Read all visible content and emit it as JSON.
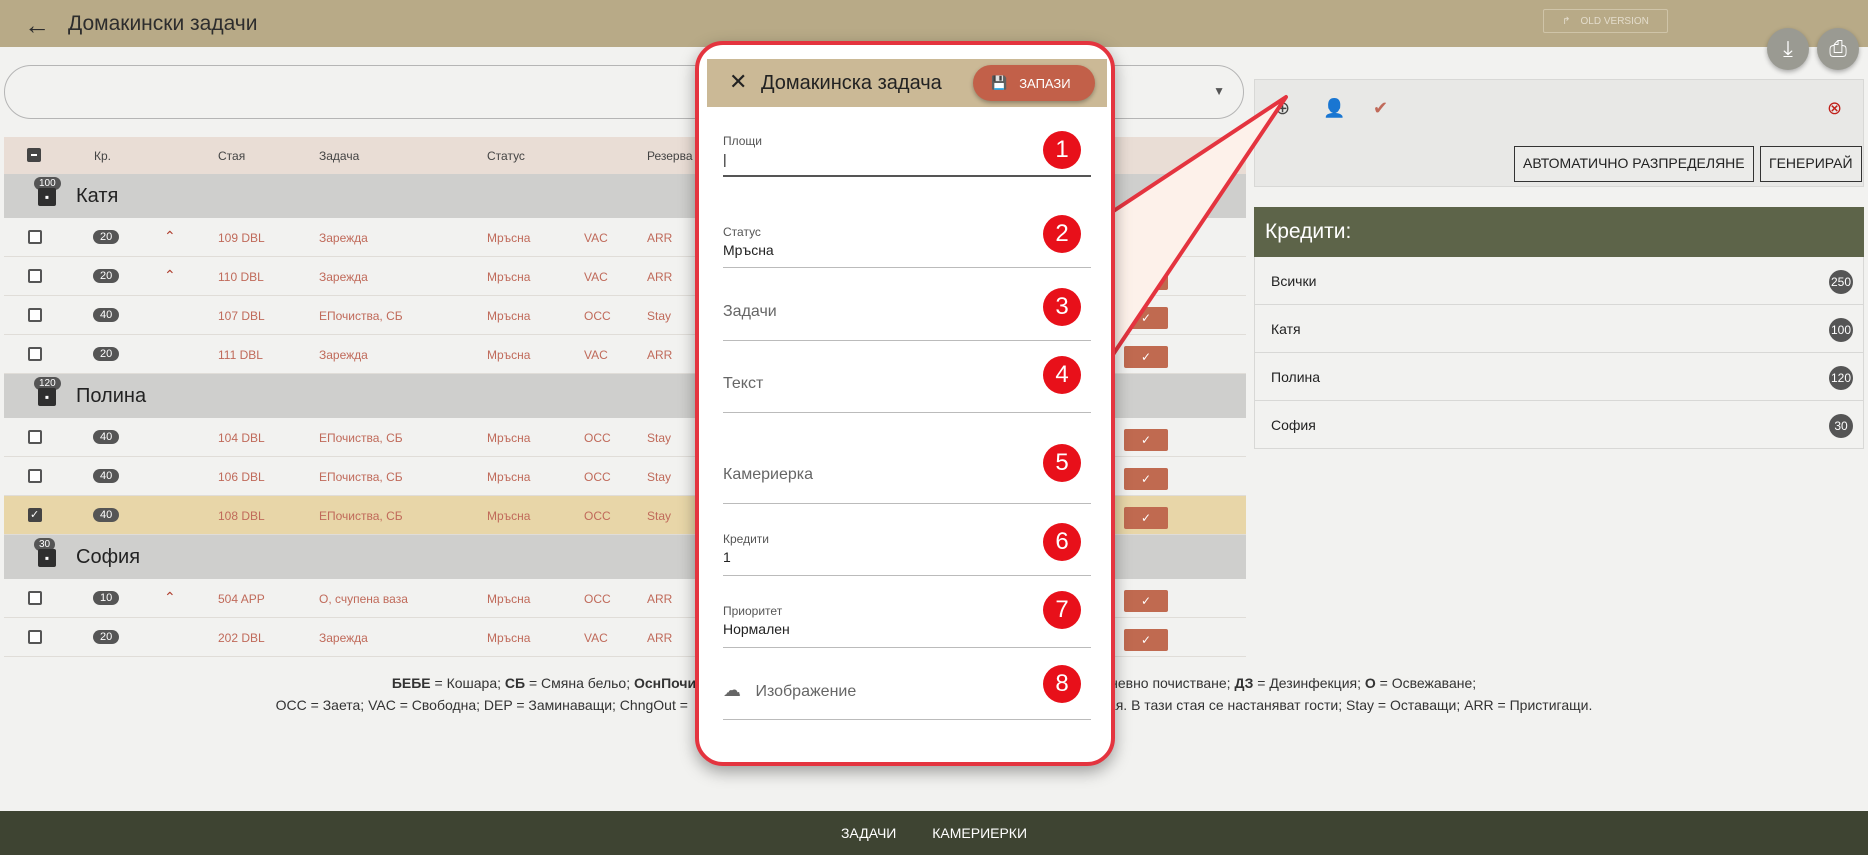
{
  "header": {
    "title": "Домакински задачи",
    "old_version": "OLD VERSION"
  },
  "table": {
    "columns": [
      "Кр.",
      "Стая",
      "Задача",
      "Статус",
      "Резерва"
    ],
    "groups": [
      {
        "name": "Катя",
        "credits": "100",
        "rows": [
          {
            "credits": "20",
            "up": true,
            "room": "109 DBL",
            "task": "Зарежда",
            "status": "Мръсна",
            "occ": "VAC",
            "res": "ARR",
            "checked": false
          },
          {
            "credits": "20",
            "up": true,
            "room": "110 DBL",
            "task": "Зарежда",
            "status": "Мръсна",
            "occ": "VAC",
            "res": "ARR",
            "checked": false
          },
          {
            "credits": "40",
            "up": false,
            "room": "107 DBL",
            "task": "ЕПочиства, СБ",
            "status": "Мръсна",
            "occ": "OCC",
            "res": "Stay",
            "checked": false
          },
          {
            "credits": "20",
            "up": false,
            "room": "111 DBL",
            "task": "Зарежда",
            "status": "Мръсна",
            "occ": "VAC",
            "res": "ARR",
            "checked": false
          }
        ]
      },
      {
        "name": "Полина",
        "credits": "120",
        "rows": [
          {
            "credits": "40",
            "up": false,
            "room": "104 DBL",
            "task": "ЕПочиства, СБ",
            "status": "Мръсна",
            "occ": "OCC",
            "res": "Stay",
            "checked": false
          },
          {
            "credits": "40",
            "up": false,
            "room": "106 DBL",
            "task": "ЕПочиства, СБ",
            "status": "Мръсна",
            "occ": "OCC",
            "res": "Stay",
            "checked": false
          },
          {
            "credits": "40",
            "up": false,
            "room": "108 DBL",
            "task": "ЕПочиства, СБ",
            "status": "Мръсна",
            "occ": "OCC",
            "res": "Stay",
            "checked": true
          }
        ]
      },
      {
        "name": "София",
        "credits": "30",
        "rows": [
          {
            "credits": "10",
            "up": true,
            "room": "504 APP",
            "task": "О, счупена ваза",
            "status": "Мръсна",
            "occ": "OCC",
            "res": "ARR",
            "checked": false
          },
          {
            "credits": "20",
            "up": false,
            "room": "202 DBL",
            "task": "Зарежда",
            "status": "Мръсна",
            "occ": "VAC",
            "res": "ARR",
            "checked": false
          }
        ]
      }
    ]
  },
  "legend": {
    "line1_a": "БЕБЕ",
    "line1_b": " = Кошара; ",
    "line1_c": "СБ",
    "line1_d": " = Смяна бельо; ",
    "line1_e": "ОснПочист",
    "line1_gap": "                                                                                ",
    "line1_f": "Ежедневно почистване; ",
    "line1_g": "ДЗ",
    "line1_h": " = Дезинфекция; ",
    "line1_i": "О",
    "line1_j": " = Освежаване;",
    "line2_left": "OCC = Заета; VAC = Свободна; DEP = Заминаващи; ChngOut =",
    "line2_right": "ая. В тази стая се настаняват гости; Stay = Оставащи; ARR = Пристигащи."
  },
  "right_panel": {
    "auto_button": "АВТОМАТИЧНО РАЗПРЕДЕЛЯНЕ",
    "generate_button": "ГЕНЕРИРАЙ",
    "credits_title": "Кредити:",
    "credits": [
      {
        "name": "Всички",
        "value": "250"
      },
      {
        "name": "Катя",
        "value": "100"
      },
      {
        "name": "Полина",
        "value": "120"
      },
      {
        "name": "София",
        "value": "30"
      }
    ]
  },
  "footer": {
    "tab1": "ЗАДАЧИ",
    "tab2": "КАМЕРИЕРКИ"
  },
  "modal": {
    "title": "Домакинска задача",
    "save": "ЗАПАЗИ",
    "fields": {
      "areas_label": "Площи",
      "status_label": "Статус",
      "status_value": "Мръсна",
      "tasks_placeholder": "Задачи",
      "text_placeholder": "Текст",
      "maid_placeholder": "Камериерка",
      "credits_label": "Кредити",
      "credits_value": "1",
      "priority_label": "Приоритет",
      "priority_value": "Нормален",
      "image_placeholder": "Изображение"
    },
    "badges": [
      "1",
      "2",
      "3",
      "4",
      "5",
      "6",
      "7",
      "8"
    ]
  },
  "colors": {
    "header": "#b8aa87",
    "accent": "#c26049",
    "footer": "#3e4432",
    "callout": "#e4343f"
  }
}
